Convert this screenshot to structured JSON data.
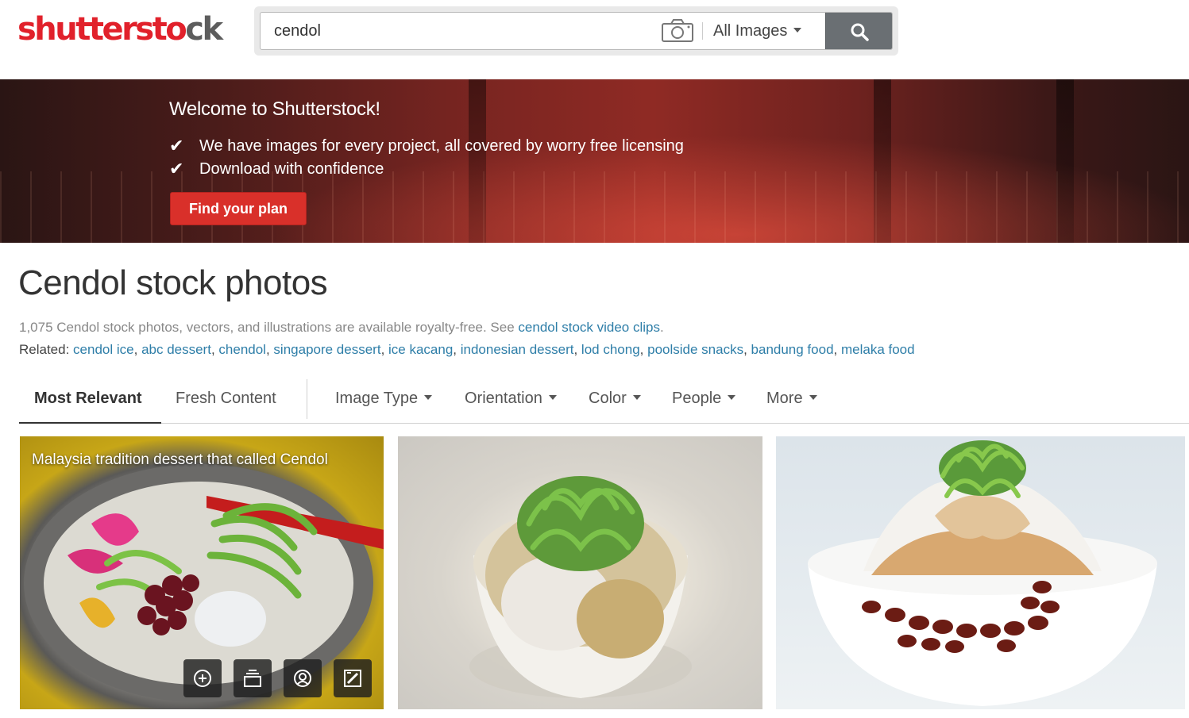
{
  "header": {
    "logo": {
      "part1": "shutterst",
      "mark": "o",
      "part2": "ck"
    },
    "search": {
      "value": "cendol",
      "type_label": "All Images"
    }
  },
  "banner": {
    "title": "Welcome to Shutterstock!",
    "points": [
      "We have images for every project, all covered by worry free licensing",
      "Download with confidence"
    ],
    "cta": "Find your plan"
  },
  "main": {
    "title": "Cendol stock photos",
    "summary": "1,075 Cendol stock photos, vectors, and illustrations are available royalty-free. See ",
    "summary_link": "cendol stock video clips",
    "summary_end": ".",
    "related_label": "Related: ",
    "related": [
      "cendol ice",
      "abc dessert",
      "chendol",
      "singapore dessert",
      "ice kacang",
      "indonesian dessert",
      "lod chong",
      "poolside snacks",
      "bandung food",
      "melaka food"
    ]
  },
  "filters": {
    "tabs": [
      "Most Relevant",
      "Fresh Content"
    ],
    "dropdowns": [
      "Image Type",
      "Orientation",
      "Color",
      "People",
      "More"
    ]
  },
  "photos": [
    {
      "caption": "Malaysia tradition dessert that called Cendol"
    }
  ],
  "colors": {
    "brand": "#e1212b",
    "link": "#2e7ea8",
    "cta": "#d9302a",
    "search_button": "#6a6f73"
  }
}
